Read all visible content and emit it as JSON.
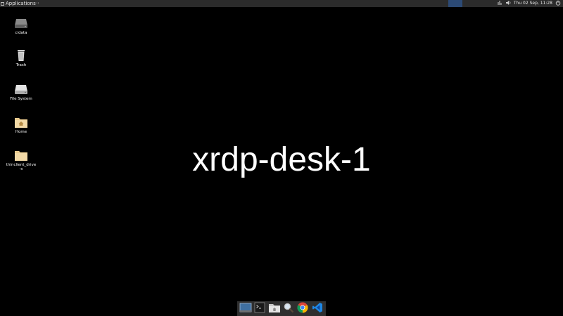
{
  "top_panel": {
    "applications_label": "Applications",
    "applications_caret": "::",
    "clock": "Thu 02 Sep, 11:28"
  },
  "desktop": {
    "icons": [
      {
        "label": "cidata",
        "icon": "drive-icon"
      },
      {
        "label": "Trash",
        "icon": "trash-icon"
      },
      {
        "label": "File System",
        "icon": "drive-icon"
      },
      {
        "label": "Home",
        "icon": "home-folder-icon"
      },
      {
        "label": "thinclient_drive-s",
        "icon": "folder-icon"
      }
    ],
    "center_label": "xrdp-desk-1"
  },
  "dock": {
    "items": [
      {
        "icon": "show-desktop-icon"
      },
      {
        "icon": "terminal-icon"
      },
      {
        "icon": "file-manager-icon"
      },
      {
        "icon": "search-icon"
      },
      {
        "icon": "chrome-icon"
      },
      {
        "icon": "vscode-icon"
      }
    ]
  },
  "colors": {
    "desktop_background": "#000000",
    "panel_background": "#2b2b2b",
    "workspace_active": "#2c4a75",
    "dock_background": "#2f2f2f",
    "vscode_blue": "#1e88e5"
  }
}
